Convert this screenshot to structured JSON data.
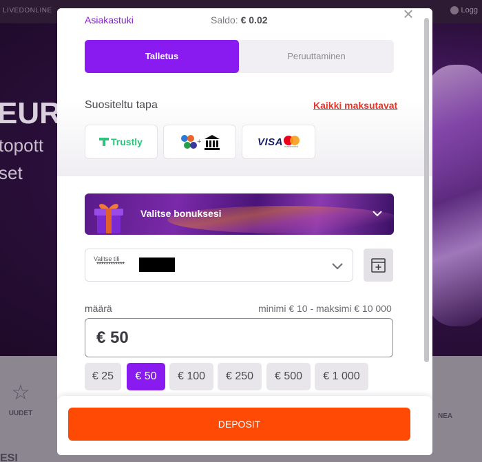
{
  "background": {
    "topbar_left": "LIVEDONLINE",
    "topbar_right": "Logg",
    "hero_line1": "EUR",
    "hero_line2": "topott",
    "hero_line3": "set",
    "nav_left_label": "UUDET",
    "nav_right_label": "NEA",
    "bottom_text": "ESI"
  },
  "header": {
    "support_link": "Asiakastuki",
    "balance_label": "Saldo:",
    "balance_value": "€ 0.02"
  },
  "tabs": [
    {
      "label": "Talletus",
      "active": true
    },
    {
      "label": "Peruuttaminen",
      "active": false
    }
  ],
  "methods": {
    "title": "Suositeltu tapa",
    "all_link": "Kaikki maksutavat",
    "options": [
      {
        "icon": "trustly-logo",
        "label": "Trustly"
      },
      {
        "icon": "bank-transfer-icon"
      },
      {
        "icon": "visa-mastercard-logo",
        "label": "VISA",
        "sub": "mastercard"
      }
    ]
  },
  "bonus": {
    "label": "Valitse bonuksesi"
  },
  "account": {
    "label": "Valitse tili",
    "value": "************"
  },
  "amount": {
    "label": "määrä",
    "limits": "minimi € 10 - maksimi € 10 000",
    "value": "€ 50"
  },
  "presets": [
    {
      "label": "€ 25",
      "active": false
    },
    {
      "label": "€ 50",
      "active": true
    },
    {
      "label": "€ 100",
      "active": false
    },
    {
      "label": "€ 250",
      "active": false
    },
    {
      "label": "€ 500",
      "active": false
    },
    {
      "label": "€ 1 000",
      "active": false
    }
  ],
  "footer": {
    "deposit_label": "DEPOSIT"
  },
  "colors": {
    "accent_purple": "#8a1bf0",
    "deposit_orange": "#fe4a04",
    "link_red": "#e5362a",
    "support_purple": "#8a1ed6"
  }
}
